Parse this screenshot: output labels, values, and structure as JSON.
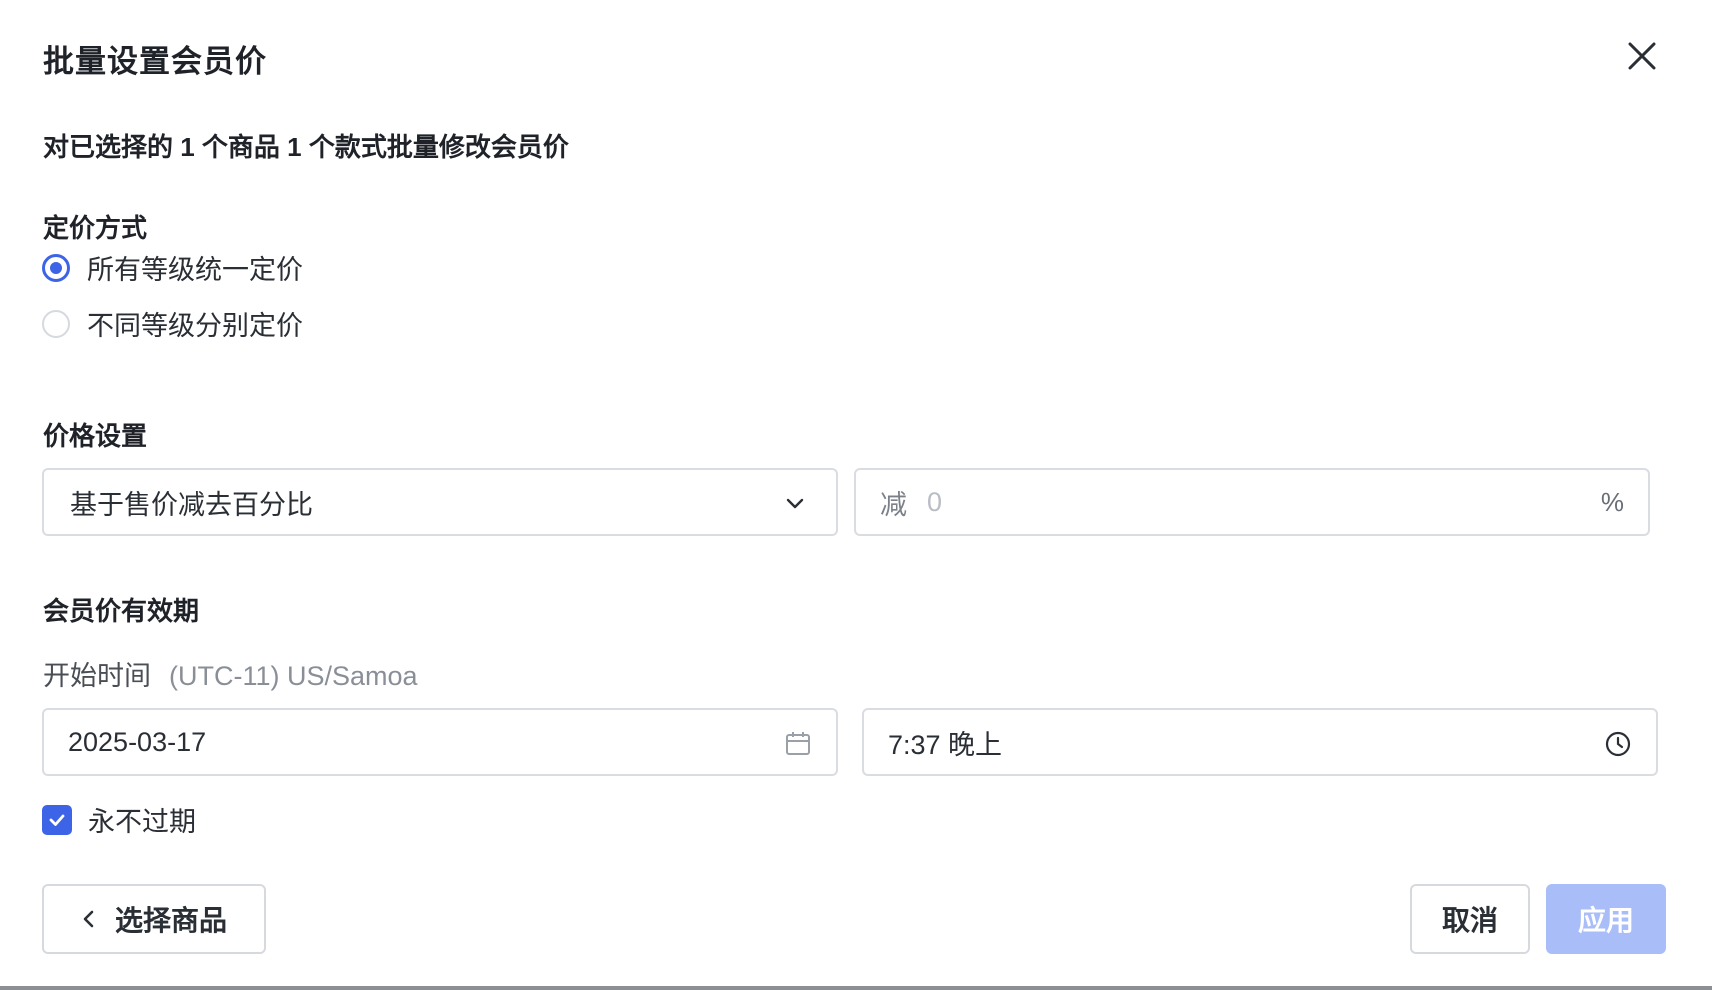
{
  "dialog": {
    "title": "批量设置会员价",
    "subtitle": "对已选择的 1 个商品 1 个款式批量修改会员价"
  },
  "pricing_method": {
    "label": "定价方式",
    "options": [
      {
        "label": "所有等级统一定价",
        "selected": true
      },
      {
        "label": "不同等级分别定价",
        "selected": false
      }
    ]
  },
  "price_setting": {
    "label": "价格设置",
    "select_value": "基于售价减去百分比",
    "prefix": "减",
    "placeholder": "0",
    "suffix": "%"
  },
  "validity": {
    "label": "会员价有效期",
    "start_label": "开始时间",
    "timezone": "(UTC-11) US/Samoa",
    "date": "2025-03-17",
    "time": "7:37 晚上",
    "never_expire_label": "永不过期",
    "never_expire_checked": true
  },
  "footer": {
    "back_label": "选择商品",
    "cancel_label": "取消",
    "apply_label": "应用"
  },
  "colors": {
    "accent": "#3d64e6",
    "apply_disabled": "#a9bdf8",
    "border": "#d9dce1"
  },
  "icons": [
    "close-icon",
    "chevron-down-icon",
    "calendar-icon",
    "clock-icon",
    "check-icon",
    "chevron-left-icon"
  ]
}
